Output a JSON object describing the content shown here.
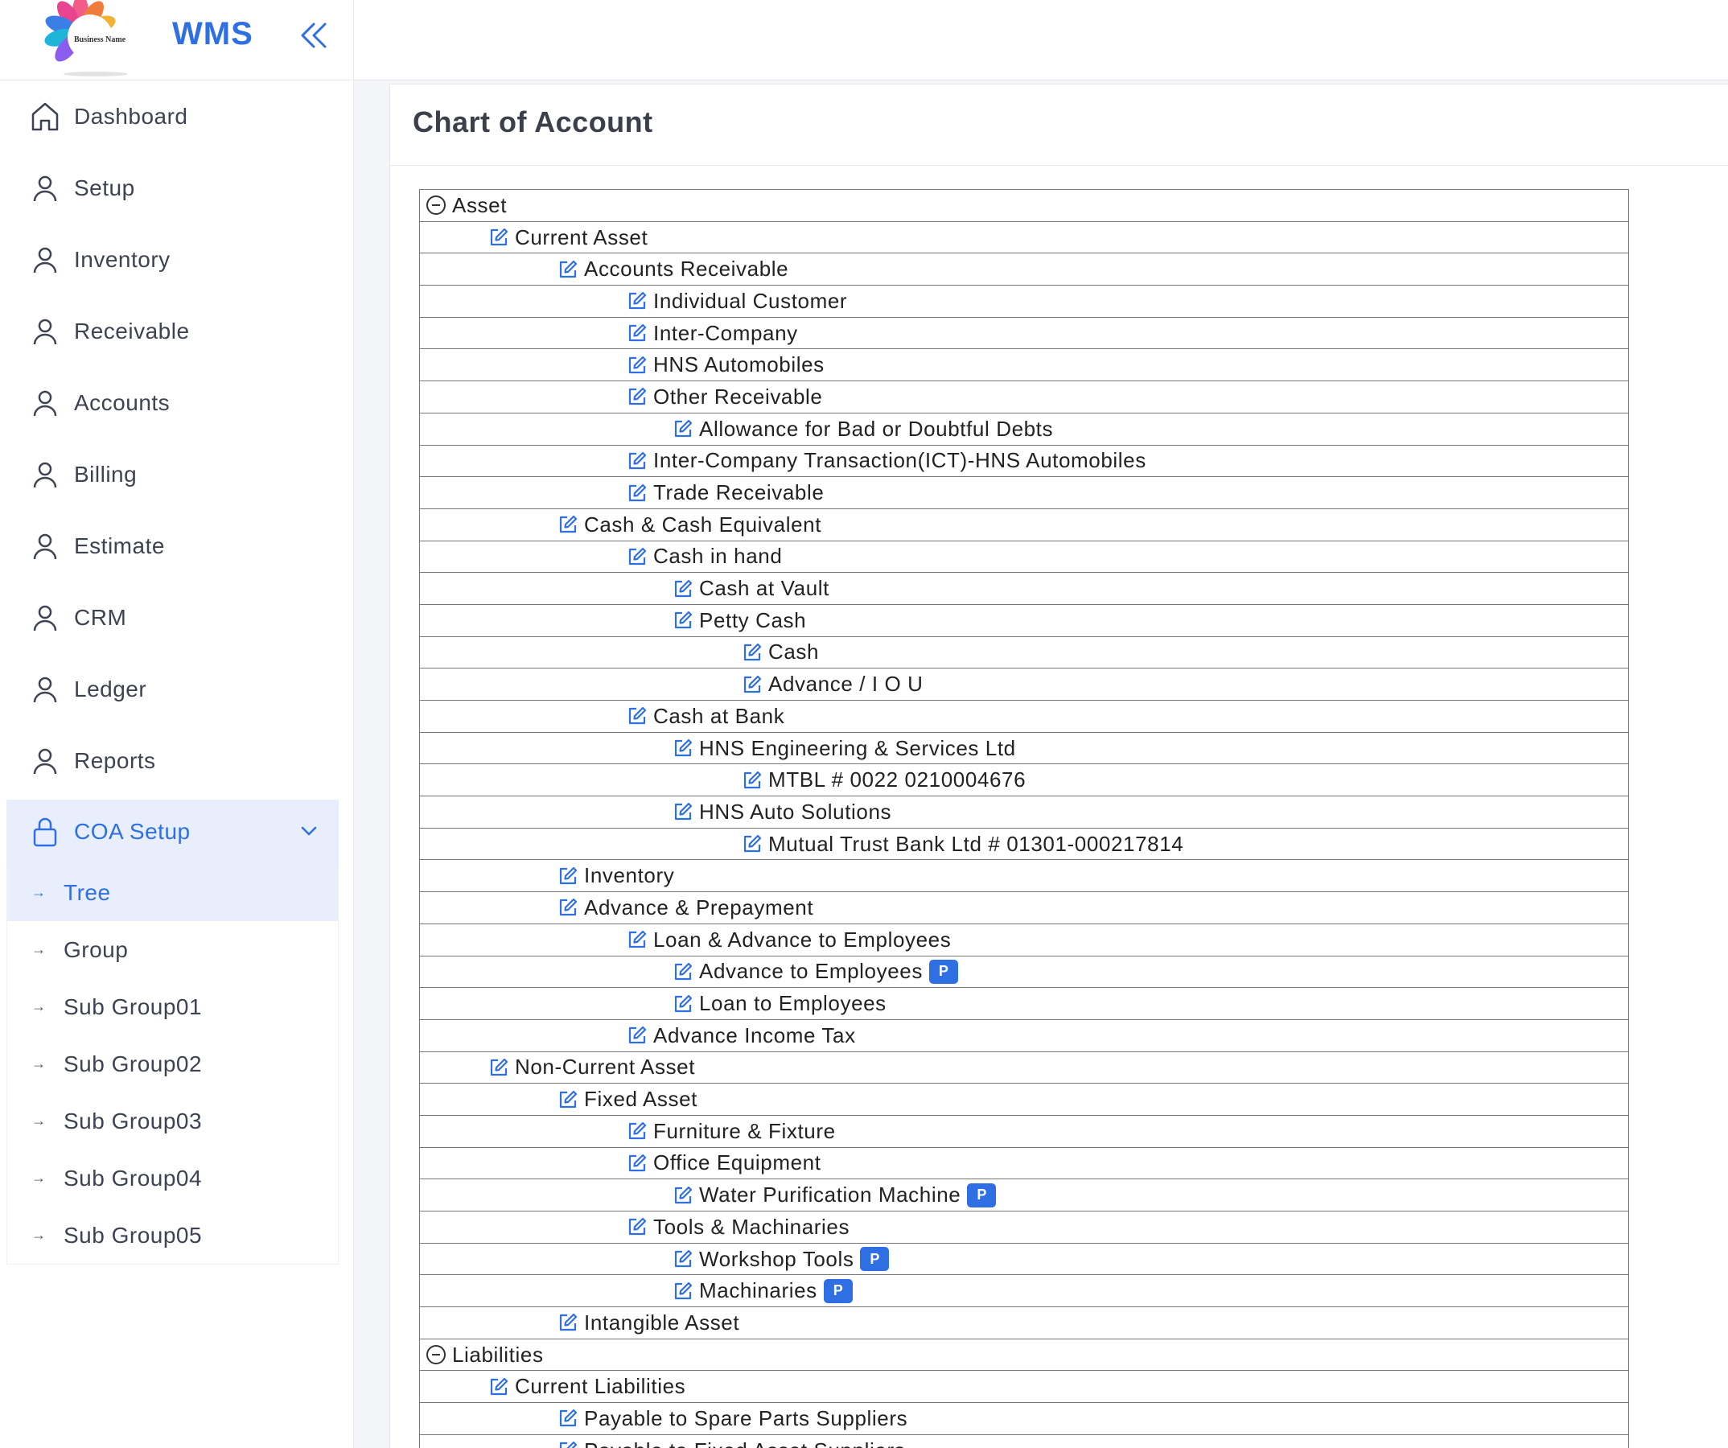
{
  "app": {
    "brand": "WMS",
    "logo_text": "Business Name"
  },
  "nav": [
    {
      "label": "Dashboard",
      "icon": "home-icon"
    },
    {
      "label": "Setup",
      "icon": "user-icon"
    },
    {
      "label": "Inventory",
      "icon": "user-icon"
    },
    {
      "label": "Receivable",
      "icon": "user-icon"
    },
    {
      "label": "Accounts",
      "icon": "user-icon"
    },
    {
      "label": "Billing",
      "icon": "user-icon"
    },
    {
      "label": "Estimate",
      "icon": "user-icon"
    },
    {
      "label": "CRM",
      "icon": "user-icon"
    },
    {
      "label": "Ledger",
      "icon": "user-icon"
    },
    {
      "label": "Reports",
      "icon": "user-icon"
    }
  ],
  "coa_setup": {
    "label": "COA Setup",
    "icon": "lock-icon",
    "expanded": true,
    "items": [
      {
        "label": "Tree",
        "active": true
      },
      {
        "label": "Group",
        "active": false
      },
      {
        "label": "Sub Group01",
        "active": false
      },
      {
        "label": "Sub Group02",
        "active": false
      },
      {
        "label": "Sub Group03",
        "active": false
      },
      {
        "label": "Sub Group04",
        "active": false
      },
      {
        "label": "Sub Group05",
        "active": false
      }
    ]
  },
  "page": {
    "title": "Chart of Account"
  },
  "colors": {
    "accent": "#2f6fe4",
    "active_bg": "#e8eefc"
  },
  "tree": [
    {
      "label": "Asset",
      "level": 0,
      "type": "collapse"
    },
    {
      "label": "Current Asset",
      "level": 1,
      "type": "edit"
    },
    {
      "label": "Accounts Receivable",
      "level": 2,
      "type": "edit"
    },
    {
      "label": "Individual Customer",
      "level": 3,
      "type": "edit"
    },
    {
      "label": "Inter-Company",
      "level": 3,
      "type": "edit"
    },
    {
      "label": "HNS Automobiles",
      "level": 3,
      "type": "edit"
    },
    {
      "label": "Other Receivable",
      "level": 3,
      "type": "edit"
    },
    {
      "label": "Allowance for Bad or Doubtful Debts",
      "level": 4,
      "type": "edit"
    },
    {
      "label": "Inter-Company Transaction(ICT)-HNS Automobiles",
      "level": 3,
      "type": "edit"
    },
    {
      "label": "Trade Receivable",
      "level": 3,
      "type": "edit"
    },
    {
      "label": "Cash & Cash Equivalent",
      "level": 2,
      "type": "edit"
    },
    {
      "label": "Cash in hand",
      "level": 3,
      "type": "edit"
    },
    {
      "label": "Cash at Vault",
      "level": 4,
      "type": "edit"
    },
    {
      "label": "Petty Cash",
      "level": 4,
      "type": "edit"
    },
    {
      "label": "Cash",
      "level": 5,
      "type": "edit"
    },
    {
      "label": "Advance / I O U",
      "level": 5,
      "type": "edit"
    },
    {
      "label": "Cash at Bank",
      "level": 3,
      "type": "edit"
    },
    {
      "label": "HNS Engineering & Services Ltd",
      "level": 4,
      "type": "edit"
    },
    {
      "label": "MTBL # 0022 0210004676",
      "level": 5,
      "type": "edit"
    },
    {
      "label": "HNS Auto Solutions",
      "level": 4,
      "type": "edit"
    },
    {
      "label": "Mutual Trust Bank Ltd # 01301-000217814",
      "level": 5,
      "type": "edit"
    },
    {
      "label": "Inventory",
      "level": 2,
      "type": "edit"
    },
    {
      "label": "Advance & Prepayment",
      "level": 2,
      "type": "edit"
    },
    {
      "label": "Loan & Advance to Employees",
      "level": 3,
      "type": "edit"
    },
    {
      "label": "Advance to Employees",
      "level": 4,
      "type": "edit",
      "badge": "P"
    },
    {
      "label": "Loan to Employees",
      "level": 4,
      "type": "edit"
    },
    {
      "label": "Advance Income Tax",
      "level": 3,
      "type": "edit"
    },
    {
      "label": "Non-Current Asset",
      "level": 1,
      "type": "edit"
    },
    {
      "label": "Fixed Asset",
      "level": 2,
      "type": "edit"
    },
    {
      "label": "Furniture & Fixture",
      "level": 3,
      "type": "edit"
    },
    {
      "label": "Office Equipment",
      "level": 3,
      "type": "edit"
    },
    {
      "label": "Water Purification Machine",
      "level": 4,
      "type": "edit",
      "badge": "P"
    },
    {
      "label": "Tools & Machinaries",
      "level": 3,
      "type": "edit"
    },
    {
      "label": "Workshop Tools",
      "level": 4,
      "type": "edit",
      "badge": "P"
    },
    {
      "label": "Machinaries",
      "level": 4,
      "type": "edit",
      "badge": "P"
    },
    {
      "label": "Intangible Asset",
      "level": 2,
      "type": "edit"
    },
    {
      "label": "Liabilities",
      "level": 0,
      "type": "collapse"
    },
    {
      "label": "Current Liabilities",
      "level": 1,
      "type": "edit"
    },
    {
      "label": "Payable to Spare Parts Suppliers",
      "level": 2,
      "type": "edit"
    },
    {
      "label": "Payable to Fixed Asset Suppliers",
      "level": 2,
      "type": "edit"
    }
  ]
}
